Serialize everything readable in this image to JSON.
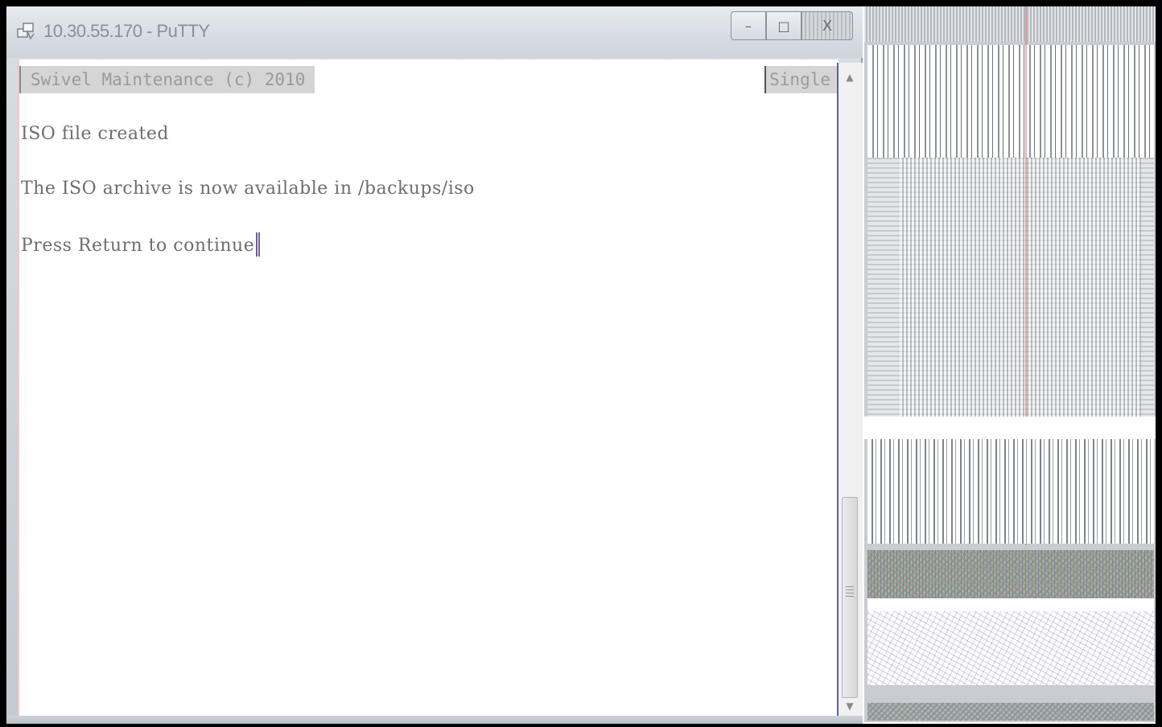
{
  "window": {
    "title": "10.30.55.170 - PuTTY",
    "controls": {
      "minimize": "–",
      "maximize": "□",
      "close": "X"
    }
  },
  "terminal": {
    "status_left": "Swivel Maintenance (c) 2010",
    "status_right": "Single",
    "lines": [
      "ISO file created",
      "The ISO archive is now available in /backups/iso",
      "Press Return to continue"
    ]
  },
  "scrollbar": {
    "up_arrow": "▲",
    "down_arrow": "▼",
    "icons": [
      "scroll-up-arrow-icon",
      "scroll-down-arrow-icon",
      "thumb-grip-icon"
    ]
  },
  "icons": [
    "putty-app-icon",
    "minimize-icon",
    "maximize-icon",
    "close-icon"
  ],
  "colors": {
    "terminal_background": "#ffffff",
    "terminal_text": "#6e6e6e",
    "status_bar": "#d5d5d5",
    "title_bar": "#d7dce3"
  }
}
